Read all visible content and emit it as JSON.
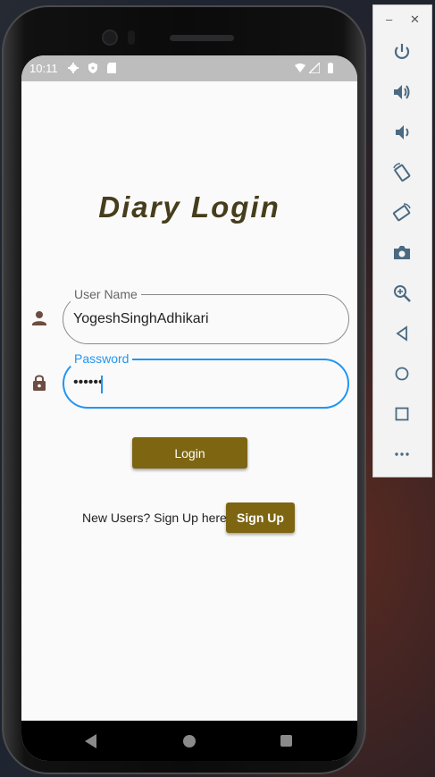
{
  "status_bar": {
    "time": "10:11"
  },
  "app": {
    "title": "Diary Login",
    "username": {
      "label": "User Name",
      "value": "YogeshSinghAdhikari"
    },
    "password": {
      "label": "Password",
      "value": "••••••"
    },
    "login_label": "Login",
    "signup_prompt": "New Users? Sign Up here",
    "signup_label": "Sign Up"
  },
  "colors": {
    "title": "#463d1c",
    "button": "#7d6512",
    "focus": "#2196f3",
    "icon": "#6d4c41"
  },
  "toolbar": {
    "items": [
      "minimize-icon",
      "close-icon",
      "power-icon",
      "volume-up-icon",
      "volume-down-icon",
      "rotate-left-icon",
      "rotate-right-icon",
      "camera-icon",
      "zoom-icon",
      "back-icon",
      "home-icon",
      "overview-icon",
      "more-icon"
    ]
  }
}
